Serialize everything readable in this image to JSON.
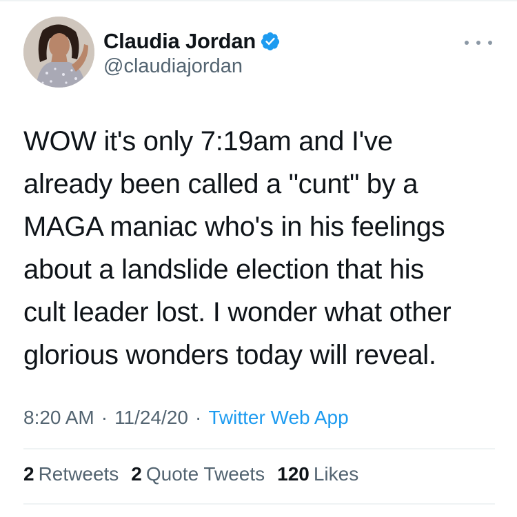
{
  "author": {
    "display_name": "Claudia Jordan",
    "handle": "@claudiajordan",
    "verified_icon": "verified-badge-icon",
    "avatar_icon": "profile-photo"
  },
  "tweet": {
    "text": "WOW it's only 7:19am and I've\nalready been called a \"cunt\" by a\nMAGA maniac who's in his feelings\nabout a landslide election that his\ncult leader lost. I wonder what other\nglorious wonders today will reveal."
  },
  "meta": {
    "time": "8:20 AM",
    "separator": "·",
    "date": "11/24/20",
    "source": "Twitter Web App"
  },
  "stats": {
    "retweets_count": "2",
    "retweets_label": "Retweets",
    "quotes_count": "2",
    "quotes_label": "Quote Tweets",
    "likes_count": "120",
    "likes_label": "Likes"
  },
  "colors": {
    "accent": "#1d9bf0",
    "secondary_text": "#536471",
    "primary_text": "#0f1419",
    "divider": "#eff3f4"
  }
}
